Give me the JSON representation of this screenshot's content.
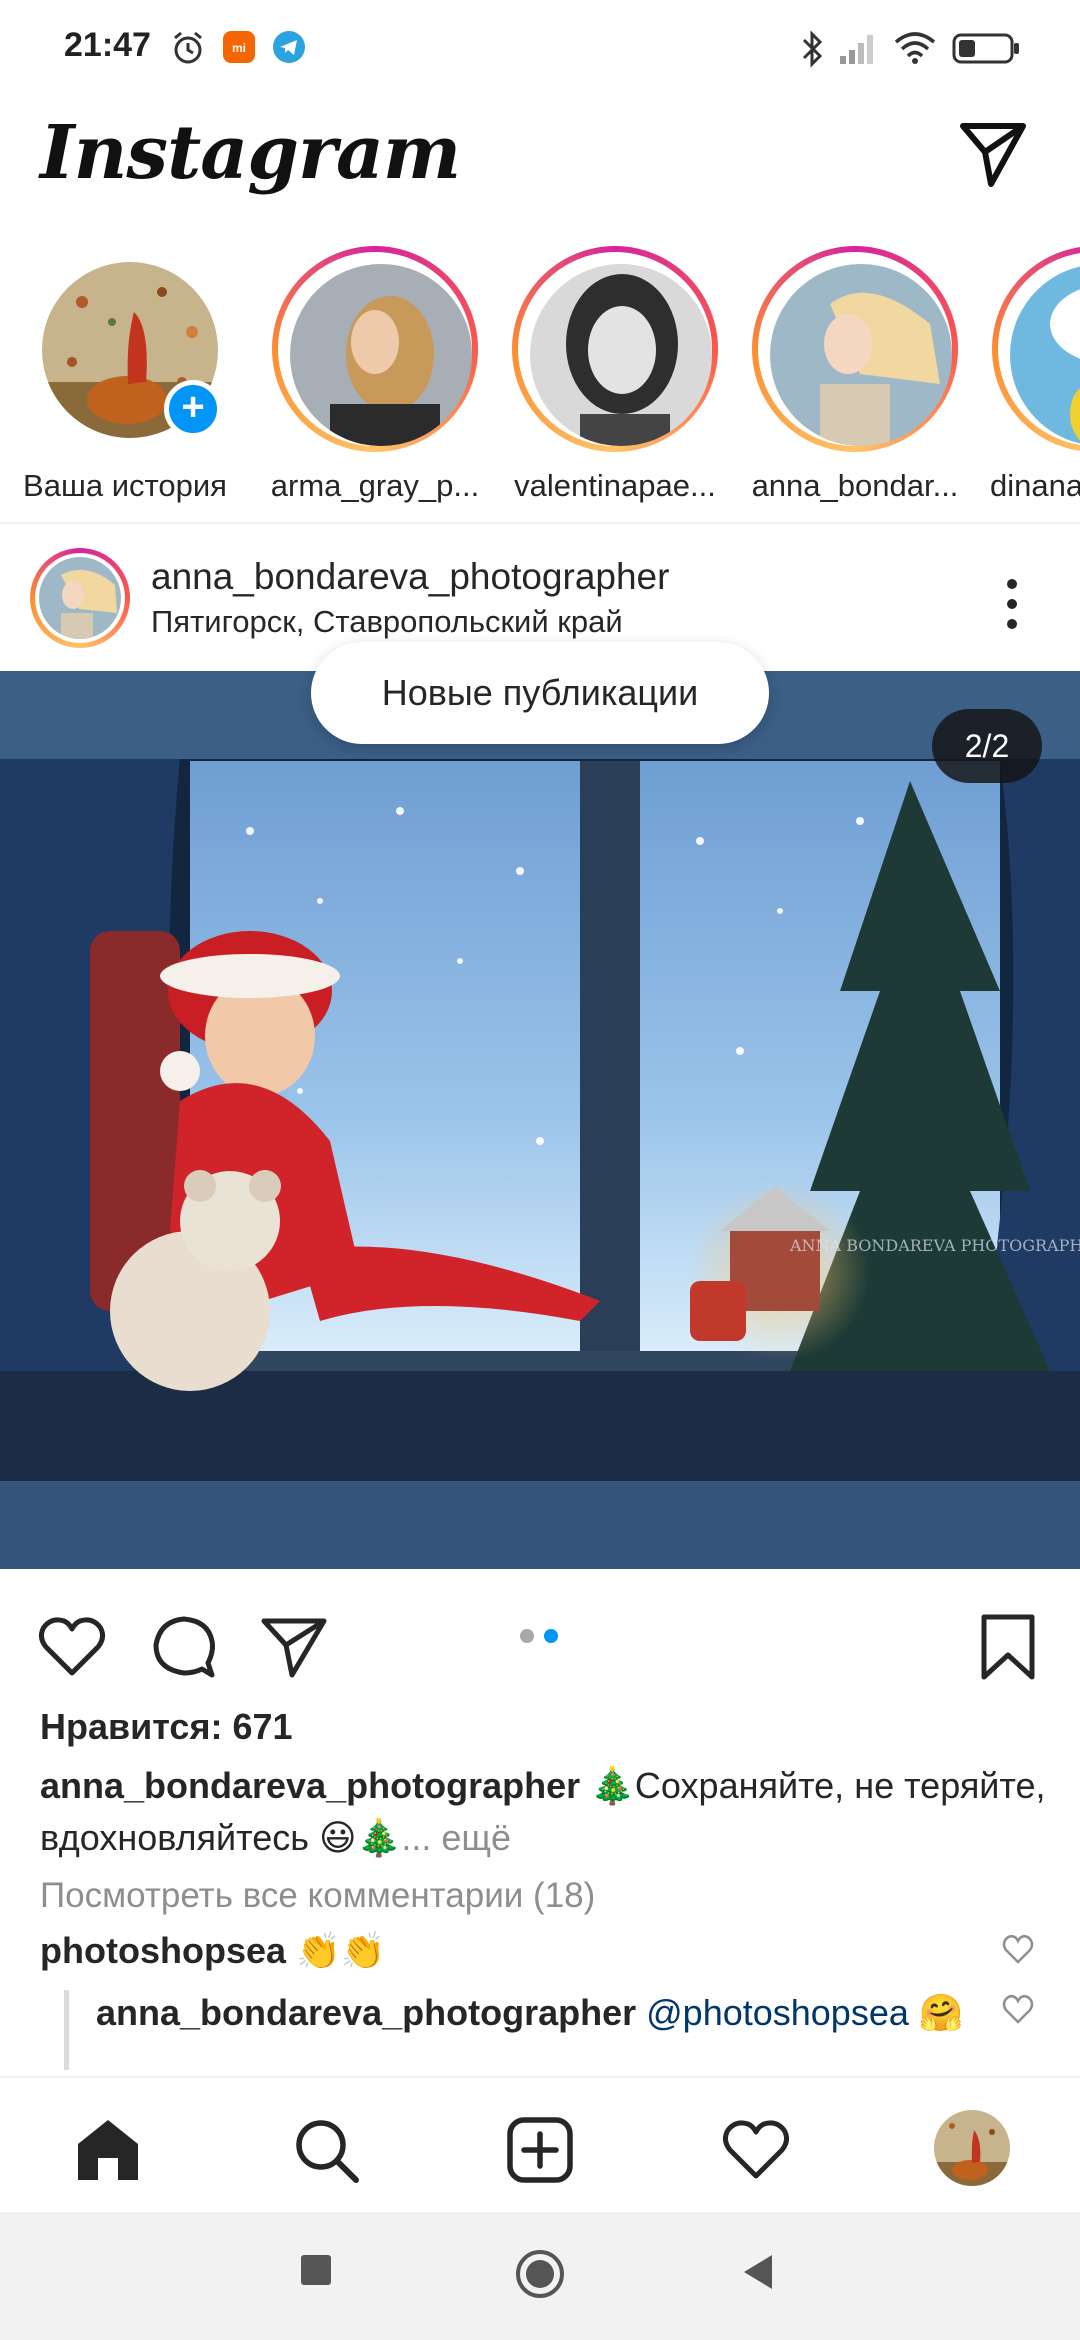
{
  "status_bar": {
    "time": "21:47",
    "icons": [
      "alarm-icon",
      "mi-icon",
      "telegram-icon",
      "bluetooth-icon",
      "signal-icon",
      "wifi-icon",
      "battery-icon"
    ]
  },
  "header": {
    "logo": "Instagram",
    "dm_icon": "paper-plane-icon"
  },
  "stories": [
    {
      "label": "Ваша история",
      "own": true
    },
    {
      "label": "arma_gray_p..."
    },
    {
      "label": "valentinapae..."
    },
    {
      "label": "anna_bondar..."
    },
    {
      "label": "dinana"
    }
  ],
  "post": {
    "username": "anna_bondareva_photographer",
    "location": "Пятигорск, Ставропольский край",
    "new_posts_label": "Новые публикации",
    "counter": "2/2",
    "watermark": "ANNA BONDAREVA PHOTOGRAPHY",
    "likes": "Нравится: 671",
    "caption_user": "anna_bondareva_photographer",
    "caption_text": " 🎄Сохраняйте, не теряйте, вдохновляйтесь 😃🎄",
    "caption_more": "... ещё",
    "view_comments": "Посмотреть все комментарии (18)",
    "comments": [
      {
        "user": "photoshopsea",
        "text": " 👏👏"
      },
      {
        "user": "anna_bondareva_photographer",
        "mention": "@photoshopsea",
        "text": " 🤗"
      }
    ],
    "carousel": {
      "active_index": 2,
      "total": 2
    },
    "colors": {
      "dot_active": "#0095f6",
      "dot_inactive": "#a8a8a8"
    }
  },
  "bottom_nav": [
    "home-icon",
    "search-icon",
    "add-post-icon",
    "activity-heart-icon",
    "profile-avatar"
  ],
  "system_nav": [
    "recent-apps-icon",
    "home-circle-icon",
    "back-icon"
  ]
}
